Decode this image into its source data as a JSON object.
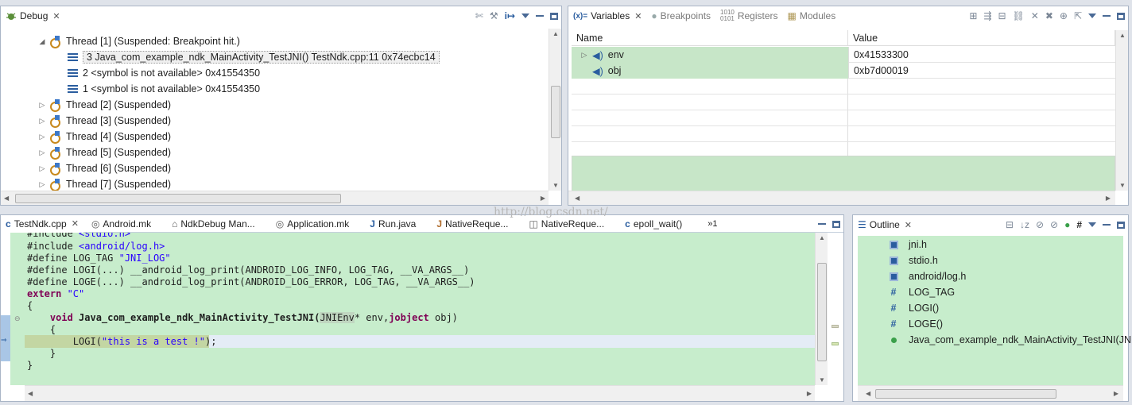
{
  "debug_view": {
    "tab_label": "Debug",
    "thread1": "Thread [1] (Suspended: Breakpoint hit.)",
    "frames": [
      "3 Java_com_example_ndk_MainActivity_TestJNI() TestNdk.cpp:11 0x74ecbc14",
      "2 <symbol is not available> 0x41554350",
      "1 <symbol is not available> 0x41554350"
    ],
    "threads": [
      "Thread [2] (Suspended)",
      "Thread [3] (Suspended)",
      "Thread [4] (Suspended)",
      "Thread [5] (Suspended)",
      "Thread [6] (Suspended)",
      "Thread [7] (Suspended)"
    ]
  },
  "variables_view": {
    "tabs": [
      "Variables",
      "Breakpoints",
      "Registers",
      "Modules"
    ],
    "col_name": "Name",
    "col_value": "Value",
    "rows": [
      {
        "name": "env",
        "value": "0x41533300"
      },
      {
        "name": "obj",
        "value": "0xb7d00019"
      }
    ]
  },
  "editor": {
    "tabs": [
      "TestNdk.cpp",
      "Android.mk",
      "NdkDebug Man...",
      "Application.mk",
      "Run.java",
      "NativeReque...",
      "NativeReque...",
      "epoll_wait()"
    ],
    "overflow": "»1",
    "watermark": "http://blog.csdn.net/",
    "lines": {
      "l0a": "#include ",
      "l0b": "<stdio.h>",
      "l1a": "#include ",
      "l1b": "<android/log.h>",
      "l2a": "#define LOG_TAG ",
      "l2b": "\"JNI_LOG\"",
      "l3": "#define LOGI(...) __android_log_print(ANDROID_LOG_INFO, LOG_TAG, __VA_ARGS__)",
      "l4": "#define LOGE(...) __android_log_print(ANDROID_LOG_ERROR, LOG_TAG, __VA_ARGS__)",
      "l5a": "extern ",
      "l5b": "\"C\"",
      "l6": "{",
      "l7a": "    ",
      "l7b": "void",
      "l7c": " Java_com_example_ndk_MainActivity_TestJNI(",
      "l7d": "JNIEnv",
      "l7e": "* env,",
      "l7f": "jobject",
      "l7g": " obj)",
      "l8": "    {",
      "l9a": "        LOGI(",
      "l9b": "\"this is a test !\"",
      "l9c": ");",
      "l10": "    }",
      "l11": "}"
    }
  },
  "outline_view": {
    "tab_label": "Outline",
    "items": [
      {
        "label": "jni.h",
        "kind": "include"
      },
      {
        "label": "stdio.h",
        "kind": "include"
      },
      {
        "label": "android/log.h",
        "kind": "include"
      },
      {
        "label": "LOG_TAG",
        "kind": "macro",
        "glyph": "#"
      },
      {
        "label": "LOGI()",
        "kind": "macro",
        "glyph": "#"
      },
      {
        "label": "LOGE()",
        "kind": "macro",
        "glyph": "#"
      },
      {
        "label": "Java_com_example_ndk_MainActivity_TestJNI(JNI",
        "kind": "function"
      }
    ]
  },
  "colors": {
    "editor_bg": "#c7edcc",
    "keyword": "#7f0055",
    "string": "#2a00ff",
    "selection_row": "#c8e6c9"
  }
}
